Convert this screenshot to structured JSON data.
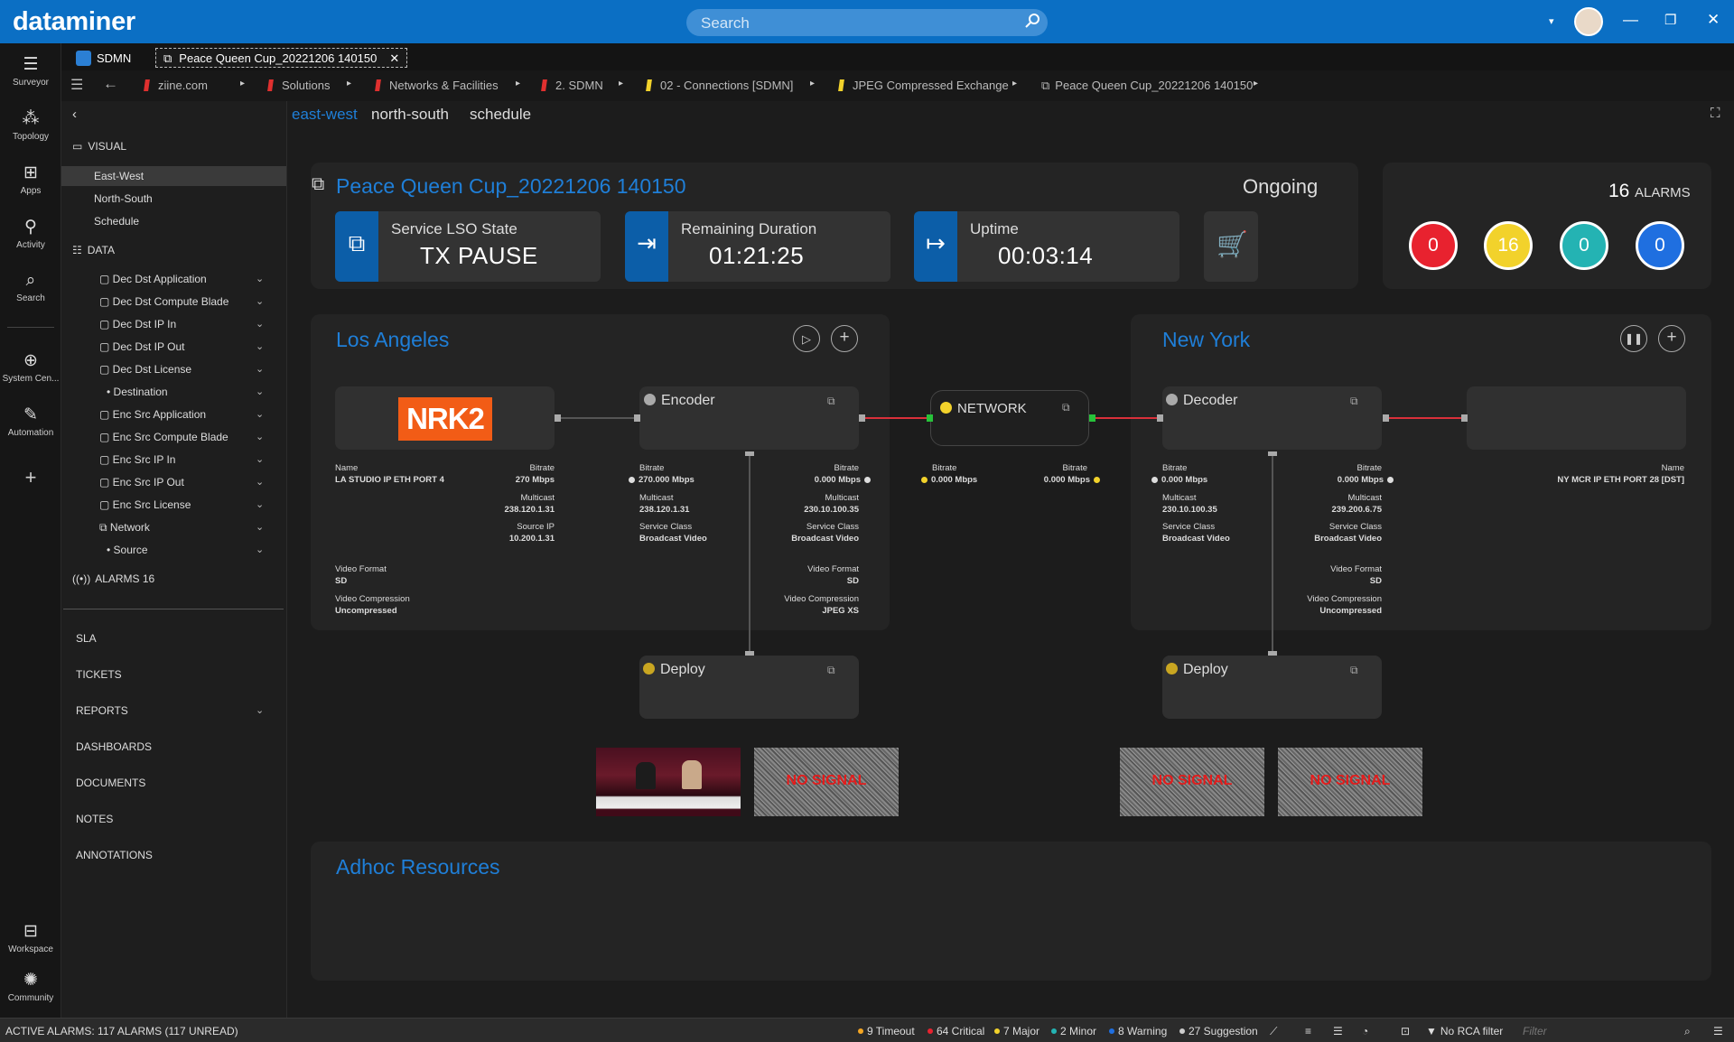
{
  "app": {
    "brand": "dataminer",
    "search_placeholder": "Search"
  },
  "rail": [
    {
      "label": "Surveyor",
      "icon": "surveyor-icon"
    },
    {
      "label": "Topology",
      "icon": "topology-icon"
    },
    {
      "label": "Apps",
      "icon": "apps-icon"
    },
    {
      "label": "Activity",
      "icon": "activity-icon"
    },
    {
      "label": "Search",
      "icon": "search-icon"
    },
    {
      "label": "System Cen...",
      "icon": "globe-icon"
    },
    {
      "label": "Automation",
      "icon": "automation-icon"
    },
    {
      "label": "Workspace",
      "icon": "workspace-icon"
    },
    {
      "label": "Community",
      "icon": "community-icon"
    }
  ],
  "tabs": {
    "first": "SDMN",
    "active": "Peace Queen Cup_20221206 140150"
  },
  "breadcrumbs": [
    {
      "label": "ziine.com",
      "color": "#e0302f"
    },
    {
      "label": "Solutions",
      "color": "#e0302f"
    },
    {
      "label": "Networks & Facilities",
      "color": "#e0302f"
    },
    {
      "label": "2. SDMN",
      "color": "#e0302f"
    },
    {
      "label": "02 - Connections [SDMN]",
      "color": "#f2d22b"
    },
    {
      "label": "JPEG Compressed Exchange",
      "color": "#f2d22b"
    },
    {
      "label": "Peace Queen Cup_20221206 140150",
      "color": ""
    }
  ],
  "side": {
    "visual_header": "VISUAL",
    "visual_items": [
      "East-West",
      "North-South",
      "Schedule"
    ],
    "data_header": "DATA",
    "data_items": [
      "Dec Dst Application",
      "Dec Dst Compute Blade",
      "Dec Dst IP In",
      "Dec Dst IP Out",
      "Dec Dst License",
      "Destination",
      "Enc Src Application",
      "Enc Src Compute Blade",
      "Enc Src IP In",
      "Enc Src IP Out",
      "Enc Src License",
      "Network",
      "Source"
    ],
    "alarms": "ALARMS 16",
    "sections": [
      "SLA",
      "TICKETS",
      "REPORTS",
      "DASHBOARDS",
      "DOCUMENTS",
      "NOTES",
      "ANNOTATIONS"
    ]
  },
  "view_tabs": [
    "east-west",
    "north-south",
    "schedule"
  ],
  "booking": {
    "title": "Peace Queen Cup_20221206 140150",
    "status": "Ongoing",
    "lso_label": "Service LSO State",
    "lso_value": "TX PAUSE",
    "remaining_label": "Remaining Duration",
    "remaining_value": "01:21:25",
    "uptime_label": "Uptime",
    "uptime_value": "00:03:14"
  },
  "alarms": {
    "count": "16",
    "label": "ALARMS",
    "circles": [
      {
        "value": "0",
        "color": "#e8222f"
      },
      {
        "value": "16",
        "color": "#f2d22b"
      },
      {
        "value": "0",
        "color": "#24b3b3"
      },
      {
        "value": "0",
        "color": "#1f6fe0"
      }
    ]
  },
  "la": {
    "title": "Los Angeles",
    "logo_text": "NRK2",
    "source": {
      "name_label": "Name",
      "name": "LA STUDIO  IP ETH PORT 4",
      "bitrate_label": "Bitrate",
      "bitrate": "270 Mbps",
      "multicast_label": "Multicast",
      "multicast": "238.120.1.31",
      "srcip_label": "Source IP",
      "srcip": "10.200.1.31",
      "vf_label": "Video Format",
      "vf": "SD",
      "vc_label": "Video Compression",
      "vc": "Uncompressed"
    },
    "encoder": {
      "title": "Encoder",
      "in_bitrate_label": "Bitrate",
      "in_bitrate": "270.000 Mbps",
      "in_multicast_label": "Multicast",
      "in_multicast": "238.120.1.31",
      "in_sc_label": "Service Class",
      "in_sc": "Broadcast Video",
      "out_bitrate_label": "Bitrate",
      "out_bitrate": "0.000 Mbps",
      "out_multicast_label": "Multicast",
      "out_multicast": "230.10.100.35",
      "out_sc_label": "Service Class",
      "out_sc": "Broadcast Video",
      "vf_label": "Video Format",
      "vf": "SD",
      "vc_label": "Video Compression",
      "vc": "JPEG XS"
    },
    "deploy": "Deploy"
  },
  "network": {
    "title": "NETWORK",
    "in_bitrate_label": "Bitrate",
    "in_bitrate": "0.000 Mbps",
    "out_bitrate_label": "Bitrate",
    "out_bitrate": "0.000 Mbps"
  },
  "ny": {
    "title": "New York",
    "decoder": {
      "title": "Decoder",
      "in_bitrate_label": "Bitrate",
      "in_bitrate": "0.000 Mbps",
      "in_multicast_label": "Multicast",
      "in_multicast": "230.10.100.35",
      "in_sc_label": "Service Class",
      "in_sc": "Broadcast Video",
      "out_bitrate_label": "Bitrate",
      "out_bitrate": "0.000 Mbps",
      "out_multicast_label": "Multicast",
      "out_multicast": "239.200.6.75",
      "out_sc_label": "Service Class",
      "out_sc": "Broadcast Video",
      "vf_label": "Video Format",
      "vf": "SD",
      "vc_label": "Video Compression",
      "vc": "Uncompressed"
    },
    "dest": {
      "name_label": "Name",
      "name": "NY MCR IP ETH PORT 28 [DST]"
    },
    "deploy": "Deploy"
  },
  "thumbs": {
    "no_signal": "NO SIGNAL"
  },
  "adhoc": {
    "title": "Adhoc Resources"
  },
  "status": {
    "active": "ACTIVE ALARMS: 117 ALARMS (117 UNREAD)",
    "items": [
      {
        "label": "9 Timeout",
        "color": "#f5a623"
      },
      {
        "label": "64 Critical",
        "color": "#e8222f"
      },
      {
        "label": "7 Major",
        "color": "#f2d22b"
      },
      {
        "label": "2 Minor",
        "color": "#24b3b3"
      },
      {
        "label": "8 Warning",
        "color": "#1f6fe0"
      },
      {
        "label": "27 Suggestion",
        "color": "#cccccc"
      }
    ],
    "rca": "No RCA filter",
    "filter_placeholder": "Filter"
  }
}
